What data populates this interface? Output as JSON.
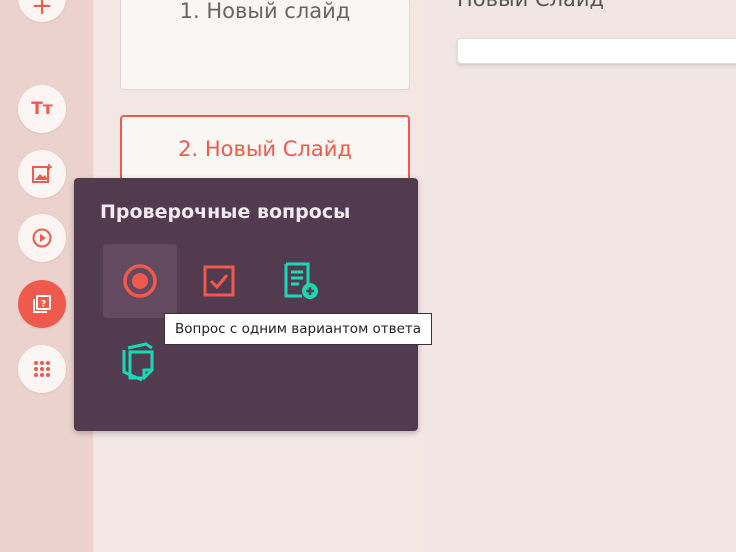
{
  "slides": [
    {
      "label": "1. Новый слайд",
      "selected": false
    },
    {
      "label": "2. Новый Слайд",
      "selected": true
    }
  ],
  "main": {
    "title": "Новый Слайд"
  },
  "sidebar": {
    "buttons": [
      {
        "name": "add-icon",
        "glyph": "+"
      },
      {
        "name": "text-icon",
        "glyph": "Тт"
      },
      {
        "name": "image-icon"
      },
      {
        "name": "video-icon"
      },
      {
        "name": "quiz-icon",
        "active": true
      },
      {
        "name": "grid-icon"
      }
    ]
  },
  "popup": {
    "title": "Проверочные вопросы",
    "items": [
      {
        "name": "single-choice-icon",
        "hovered": true
      },
      {
        "name": "multiple-choice-icon"
      },
      {
        "name": "text-answer-icon"
      },
      {
        "name": "cards-icon"
      }
    ]
  },
  "tooltip": {
    "text": "Вопрос с одним вариантом ответа"
  },
  "colors": {
    "accent": "#ef5a4d",
    "teal": "#18d9b3",
    "popup": "#533b4f"
  }
}
